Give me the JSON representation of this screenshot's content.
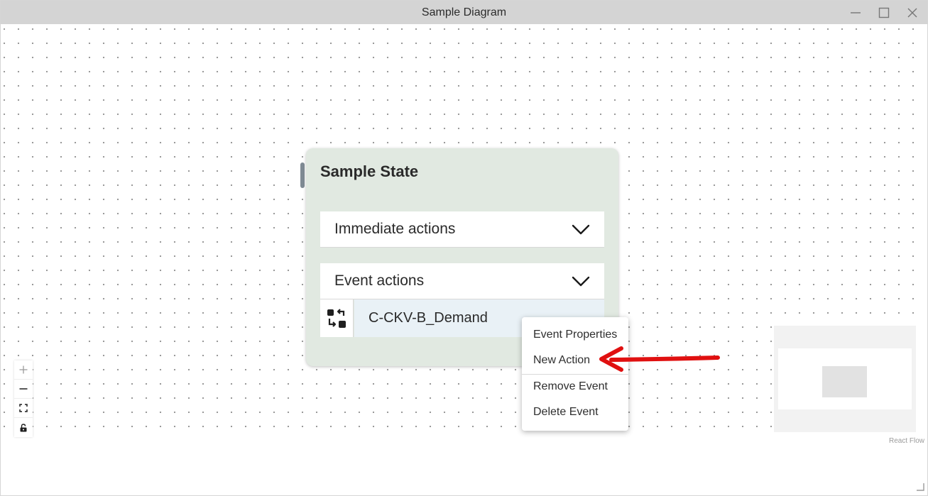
{
  "window": {
    "title": "Sample Diagram"
  },
  "node": {
    "title": "Sample State",
    "sections": {
      "immediate": "Immediate actions",
      "event": "Event actions"
    },
    "event": {
      "name": "C-CKV-B_Demand",
      "icon": "swap-icon"
    }
  },
  "context_menu": {
    "items": [
      "Event Properties",
      "New Action",
      "Remove Event",
      "Delete Event"
    ]
  },
  "annotation": {
    "arrow_color": "#e01010"
  },
  "controls": {
    "icons": [
      "zoom-in-icon",
      "zoom-out-icon",
      "fit-view-icon",
      "lock-icon"
    ]
  },
  "attribution": "React Flow",
  "colors": {
    "node_bg": "#e1e9e1",
    "event_bg": "#e9f1f6",
    "titlebar_bg": "#d4d4d4"
  }
}
